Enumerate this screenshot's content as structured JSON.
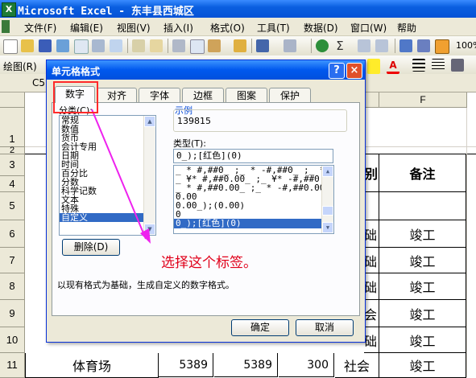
{
  "window": {
    "title": "Microsoft Excel - 东丰县西城区",
    "logo": "X"
  },
  "menu": [
    "文件(F)",
    "编辑(E)",
    "视图(V)",
    "插入(I)",
    "格式(O)",
    "工具(T)",
    "数据(D)",
    "窗口(W)",
    "帮助"
  ],
  "toolbar": {
    "zoom": "100%",
    "draw_label": "绘图(R)"
  },
  "formula": {
    "namebox": "C5"
  },
  "sheet": {
    "columns": [
      "F"
    ],
    "rows": [
      "1",
      "2",
      "3",
      "4",
      "5",
      "6",
      "7",
      "8",
      "9",
      "10",
      "11"
    ],
    "cells": {
      "e3": "别",
      "f3": "备注",
      "e6": "础",
      "f6": "竣工",
      "e7": "础",
      "f7": "竣工",
      "e8": "础",
      "f8": "竣工",
      "e9": "会",
      "f9": "竣工",
      "e10": "础",
      "f10": "竣工",
      "a11": "体育场",
      "b11": "5389",
      "c11": "5389",
      "d11": "300",
      "e11": "社会",
      "f11": "竣工"
    }
  },
  "dialog": {
    "title": "单元格格式",
    "help": "?",
    "close": "×",
    "tabs": [
      "数字",
      "对齐",
      "字体",
      "边框",
      "图案",
      "保护"
    ],
    "category_label": "分类(C):",
    "categories": [
      "常规",
      "数值",
      "货币",
      "会计专用",
      "日期",
      "时间",
      "百分比",
      "分数",
      "科学记数",
      "文本",
      "特殊",
      "自定义"
    ],
    "sample_label": "示例",
    "sample_value": "139815",
    "type_label": "类型(T):",
    "type_value": "0_);[红色](0)",
    "formats": [
      "_ * #,##0_ ;_ * -#,##0_ ;_ * \"",
      "_ ¥* #,##0.00_ ;_ ¥* -#,##0.",
      "_ * #,##0.00_ ;_ * -#,##0.00_",
      "0.00",
      "0.00_);(0.00)",
      "0",
      "0_);[红色](0)"
    ],
    "delete_button": "删除(D)",
    "hint": "以现有格式为基础，生成自定义的数字格式。",
    "ok": "确定",
    "cancel": "取消"
  },
  "annotation": "选择这个标签。",
  "colors": {
    "accent_red": "#e0001a",
    "highlight": "#ff2a2a",
    "arrow": "#ee22ee"
  }
}
